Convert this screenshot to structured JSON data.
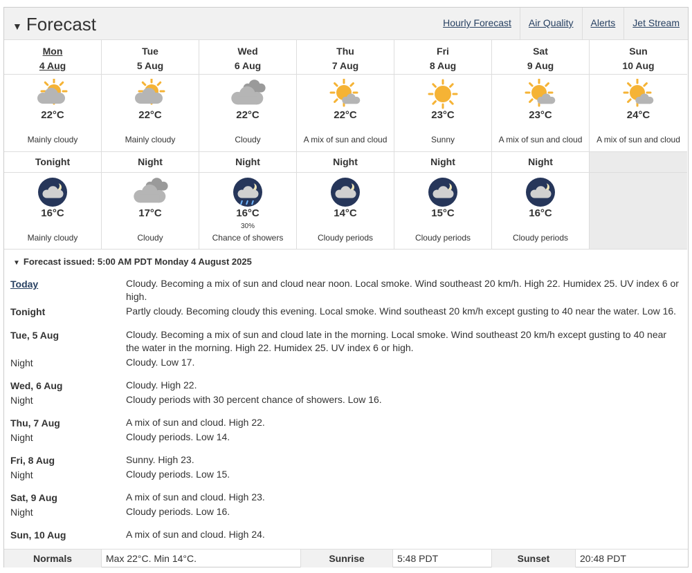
{
  "header": {
    "title": "Forecast",
    "links": [
      "Hourly Forecast",
      "Air Quality",
      "Alerts",
      "Jet Stream"
    ]
  },
  "days": [
    {
      "day": "Mon",
      "date": "4 Aug",
      "today": true,
      "icon": "sun-cloud-icon",
      "temp": "22°C",
      "cond": "Mainly cloudy"
    },
    {
      "day": "Tue",
      "date": "5 Aug",
      "icon": "sun-cloud-icon",
      "temp": "22°C",
      "cond": "Mainly cloudy"
    },
    {
      "day": "Wed",
      "date": "6 Aug",
      "icon": "cloud-icon",
      "temp": "22°C",
      "cond": "Cloudy"
    },
    {
      "day": "Thu",
      "date": "7 Aug",
      "icon": "sun-small-cloud-icon",
      "temp": "22°C",
      "cond": "A mix of sun and cloud"
    },
    {
      "day": "Fri",
      "date": "8 Aug",
      "icon": "sun-icon",
      "temp": "23°C",
      "cond": "Sunny"
    },
    {
      "day": "Sat",
      "date": "9 Aug",
      "icon": "sun-small-cloud-icon",
      "temp": "23°C",
      "cond": "A mix of sun and cloud"
    },
    {
      "day": "Sun",
      "date": "10 Aug",
      "icon": "sun-small-cloud-icon",
      "temp": "24°C",
      "cond": "A mix of sun and cloud"
    }
  ],
  "nights": [
    {
      "label": "Tonight",
      "icon": "night-cloud-icon",
      "temp": "16°C",
      "pop": "",
      "cond": "Mainly cloudy"
    },
    {
      "label": "Night",
      "icon": "cloud-icon",
      "temp": "17°C",
      "pop": "",
      "cond": "Cloudy"
    },
    {
      "label": "Night",
      "icon": "night-showers-icon",
      "temp": "16°C",
      "pop": "30%",
      "cond": "Chance of showers"
    },
    {
      "label": "Night",
      "icon": "night-cloud-icon",
      "temp": "14°C",
      "pop": "",
      "cond": "Cloudy periods"
    },
    {
      "label": "Night",
      "icon": "night-cloud-icon",
      "temp": "15°C",
      "pop": "",
      "cond": "Cloudy periods"
    },
    {
      "label": "Night",
      "icon": "night-cloud-icon",
      "temp": "16°C",
      "pop": "",
      "cond": "Cloudy periods"
    }
  ],
  "issued": "Forecast issued: 5:00 AM PDT Monday 4 August 2025",
  "details": [
    {
      "period": "Today",
      "text": "Cloudy. Becoming a mix of sun and cloud near noon. Local smoke. Wind southeast 20 km/h. High 22. Humidex 25. UV index 6 or high."
    },
    {
      "period": "Tonight",
      "text": "Partly cloudy. Becoming cloudy this evening. Local smoke. Wind southeast 20 km/h except gusting to 40 near the water. Low 16."
    },
    {
      "period": "Tue, 5 Aug",
      "text": "Cloudy. Becoming a mix of sun and cloud late in the morning. Local smoke. Wind southeast 20 km/h except gusting to 40 near the water in the morning. High 22. Humidex 25. UV index 6 or high."
    },
    {
      "period": "Night",
      "text": "Cloudy. Low 17."
    },
    {
      "period": "Wed, 6 Aug",
      "text": "Cloudy. High 22."
    },
    {
      "period": "Night",
      "text": "Cloudy periods with 30 percent chance of showers. Low 16."
    },
    {
      "period": "Thu, 7 Aug",
      "text": "A mix of sun and cloud. High 22."
    },
    {
      "period": "Night",
      "text": "Cloudy periods. Low 14."
    },
    {
      "period": "Fri, 8 Aug",
      "text": "Sunny. High 23."
    },
    {
      "period": "Night",
      "text": "Cloudy periods. Low 15."
    },
    {
      "period": "Sat, 9 Aug",
      "text": "A mix of sun and cloud. High 23."
    },
    {
      "period": "Night",
      "text": "Cloudy periods. Low 16."
    },
    {
      "period": "Sun, 10 Aug",
      "text": "A mix of sun and cloud. High 24."
    }
  ],
  "footer": {
    "normals_label": "Normals",
    "normals_value": "Max 22°C. Min 14°C.",
    "sunrise_label": "Sunrise",
    "sunrise_value": "5:48 PDT",
    "sunset_label": "Sunset",
    "sunset_value": "20:48 PDT"
  },
  "colors": {
    "link": "#284162",
    "sun": "#f5b335",
    "cloud": "#a9a9a9",
    "night": "#26365a"
  }
}
